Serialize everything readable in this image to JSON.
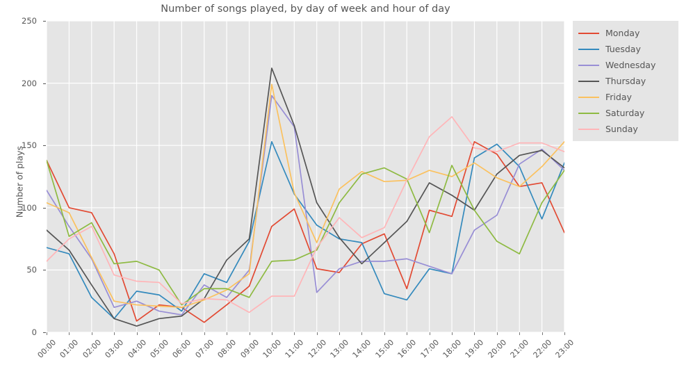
{
  "chart_data": {
    "type": "line",
    "title": "Number of songs played, by day of week and hour of day",
    "xlabel": "",
    "ylabel": "Number of plays",
    "categories": [
      "00:00",
      "01:00",
      "02:00",
      "03:00",
      "04:00",
      "05:00",
      "06:00",
      "07:00",
      "08:00",
      "09:00",
      "10:00",
      "11:00",
      "12:00",
      "13:00",
      "14:00",
      "15:00",
      "16:00",
      "17:00",
      "18:00",
      "19:00",
      "20:00",
      "21:00",
      "22:00",
      "23:00"
    ],
    "x": [
      0,
      1,
      2,
      3,
      4,
      5,
      6,
      7,
      8,
      9,
      10,
      11,
      12,
      13,
      14,
      15,
      16,
      17,
      18,
      19,
      20,
      21,
      22,
      23
    ],
    "ylim": [
      0,
      250
    ],
    "yticks": [
      0,
      50,
      100,
      150,
      200,
      250
    ],
    "grid": true,
    "legend_position": "upper right (outside)",
    "series": [
      {
        "name": "Monday",
        "color": "#e24a33",
        "values": [
          138,
          100,
          96,
          63,
          9,
          22,
          20,
          8,
          22,
          37,
          85,
          99,
          51,
          48,
          71,
          79,
          35,
          98,
          93,
          153,
          143,
          117,
          120,
          80
        ]
      },
      {
        "name": "Tuesday",
        "color": "#348abd",
        "values": [
          68,
          63,
          28,
          11,
          33,
          30,
          17,
          47,
          40,
          73,
          153,
          111,
          86,
          75,
          72,
          31,
          26,
          51,
          47,
          140,
          151,
          133,
          91,
          136
        ]
      },
      {
        "name": "Wednesday",
        "color": "#988ed5",
        "values": [
          114,
          85,
          59,
          20,
          25,
          17,
          14,
          38,
          28,
          50,
          190,
          165,
          32,
          51,
          57,
          57,
          59,
          53,
          47,
          82,
          94,
          135,
          147,
          130
        ]
      },
      {
        "name": "Thursday",
        "color": "#555555",
        "values": [
          82,
          66,
          38,
          11,
          5,
          11,
          13,
          27,
          58,
          75,
          212,
          166,
          104,
          76,
          55,
          72,
          89,
          120,
          110,
          98,
          127,
          142,
          146,
          132
        ]
      },
      {
        "name": "Friday",
        "color": "#fbc15e",
        "values": [
          104,
          96,
          60,
          25,
          22,
          21,
          20,
          26,
          34,
          47,
          199,
          112,
          72,
          115,
          129,
          121,
          122,
          130,
          125,
          136,
          124,
          117,
          133,
          153
        ]
      },
      {
        "name": "Saturday",
        "color": "#8eba42",
        "values": [
          138,
          77,
          88,
          55,
          57,
          50,
          22,
          35,
          35,
          28,
          57,
          58,
          66,
          104,
          127,
          132,
          123,
          80,
          134,
          98,
          73,
          63,
          104,
          130
        ]
      },
      {
        "name": "Sunday",
        "color": "#ffb5b8",
        "values": [
          57,
          75,
          85,
          46,
          41,
          40,
          23,
          27,
          26,
          16,
          29,
          29,
          68,
          92,
          76,
          84,
          122,
          157,
          173,
          148,
          145,
          152,
          152,
          145
        ]
      }
    ]
  },
  "axes": {
    "ytick_labels": [
      "0",
      "50",
      "100",
      "150",
      "200",
      "250"
    ],
    "xtick_labels": [
      "00:00",
      "01:00",
      "02:00",
      "03:00",
      "04:00",
      "05:00",
      "06:00",
      "07:00",
      "08:00",
      "09:00",
      "10:00",
      "11:00",
      "12:00",
      "13:00",
      "14:00",
      "15:00",
      "16:00",
      "17:00",
      "18:00",
      "19:00",
      "20:00",
      "21:00",
      "22:00",
      "23:00"
    ]
  },
  "style": {
    "figure_background": "#ffffff",
    "axes_background": "#e5e5e5",
    "grid_color": "#ffffff",
    "text_color": "#555555",
    "legend_background": "#e5e5e5"
  }
}
